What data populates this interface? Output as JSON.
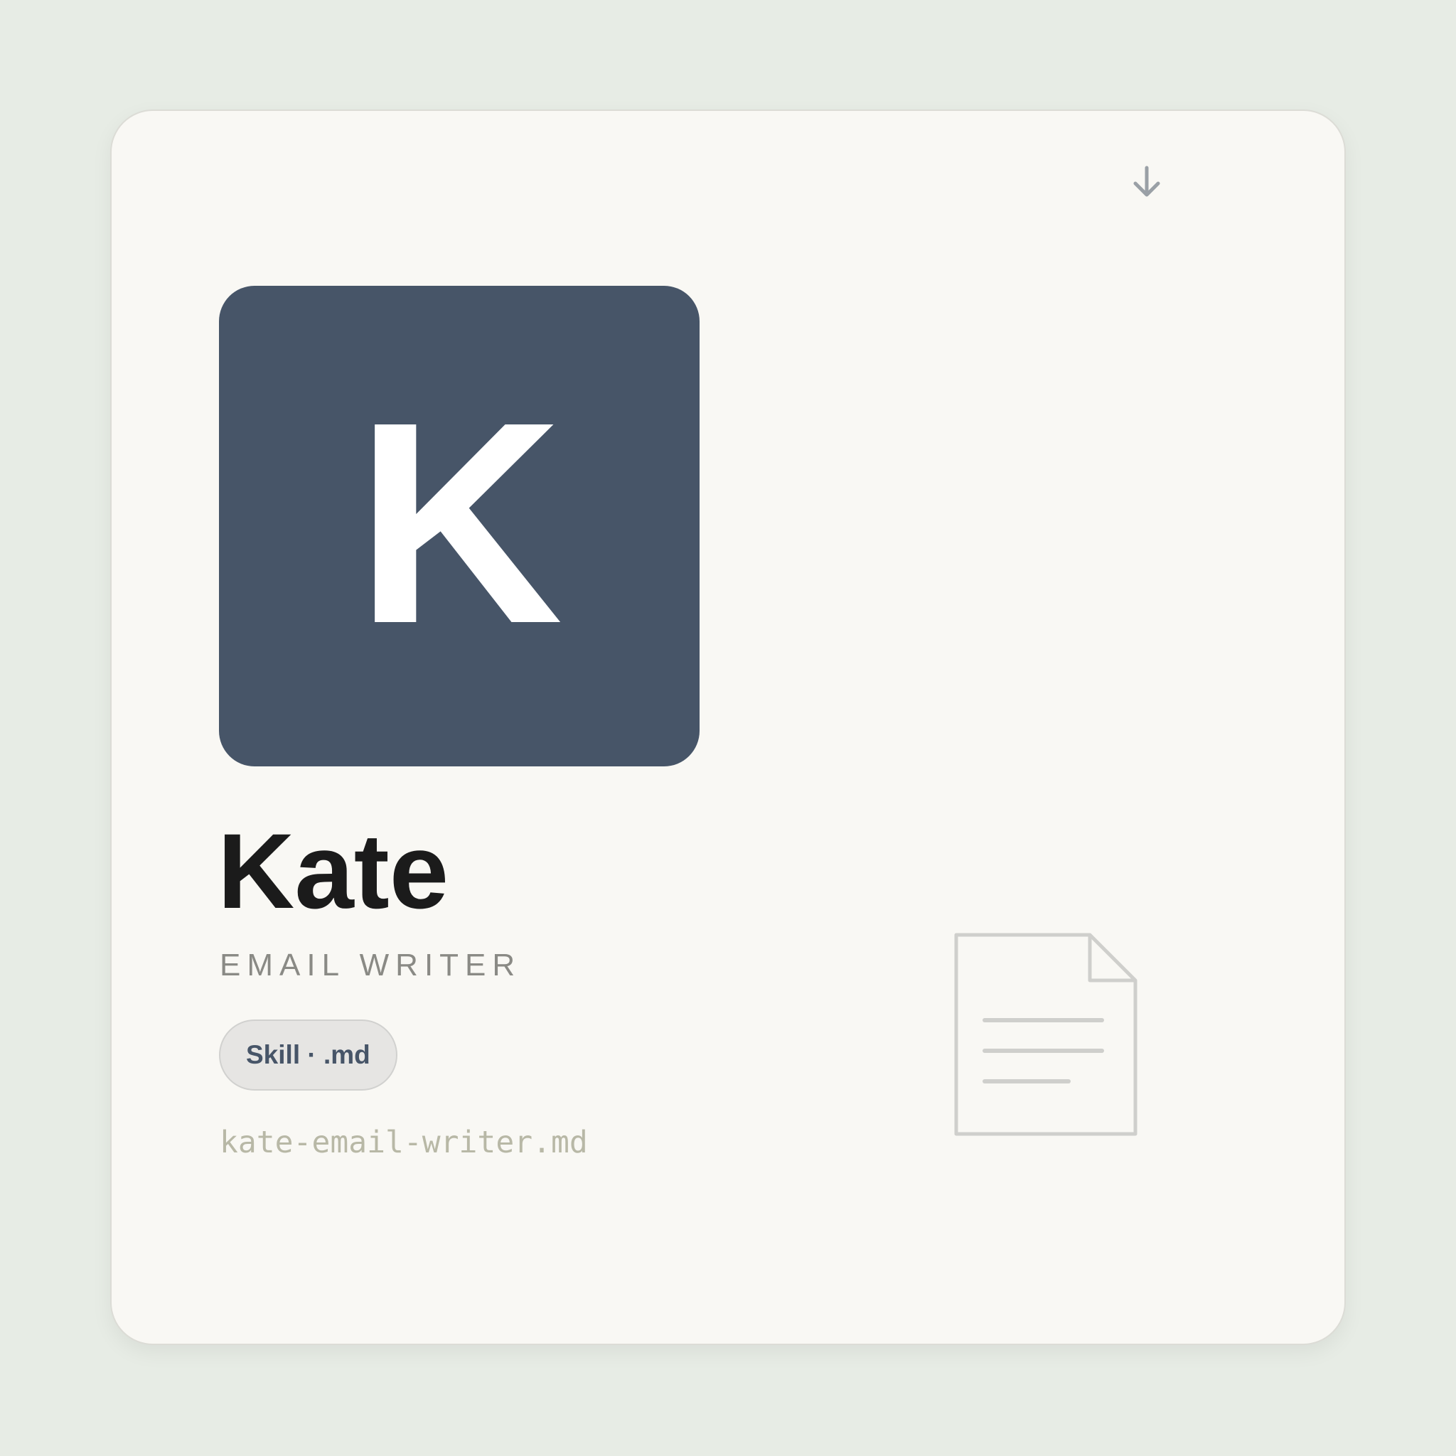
{
  "card": {
    "avatar_letter": "K",
    "name": "Kate",
    "role": "EMAIL WRITER",
    "badge": "Skill · .md",
    "filename": "kate-email-writer.md"
  },
  "icons": {
    "download": "download-arrow-icon",
    "document": "document-icon"
  },
  "colors": {
    "background": "#e7ece5",
    "card": "#f9f8f4",
    "avatar": "#475568",
    "name": "#1b1b1b",
    "role": "#8a8a85",
    "badge_bg": "#e6e5e3",
    "badge_text": "#475568",
    "filename": "#b8b8a6"
  }
}
